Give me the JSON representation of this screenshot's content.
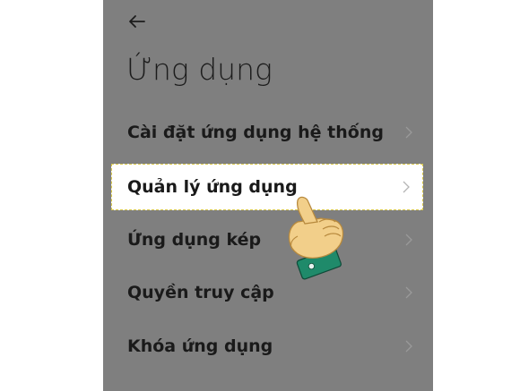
{
  "header": {
    "back_icon": "arrow-left-icon",
    "title": "Ứng dụng"
  },
  "menu": {
    "items": [
      {
        "label": "Cài đặt ứng dụng hệ thống",
        "highlighted": false
      },
      {
        "label": "Quản lý ứng dụng",
        "highlighted": true
      },
      {
        "label": "Ứng dụng kép",
        "highlighted": false
      },
      {
        "label": "Quyền truy cập",
        "highlighted": false
      },
      {
        "label": "Khóa ứng dụng",
        "highlighted": false
      }
    ],
    "chevron_icon": "chevron-right-icon"
  },
  "overlay": {
    "pointer_icon": "pointing-hand-icon"
  },
  "colors": {
    "screen_background": "#7f7f7f",
    "highlight_background": "#ffffff",
    "highlight_border": "#d9c84a",
    "text": "#1a1a1a"
  }
}
